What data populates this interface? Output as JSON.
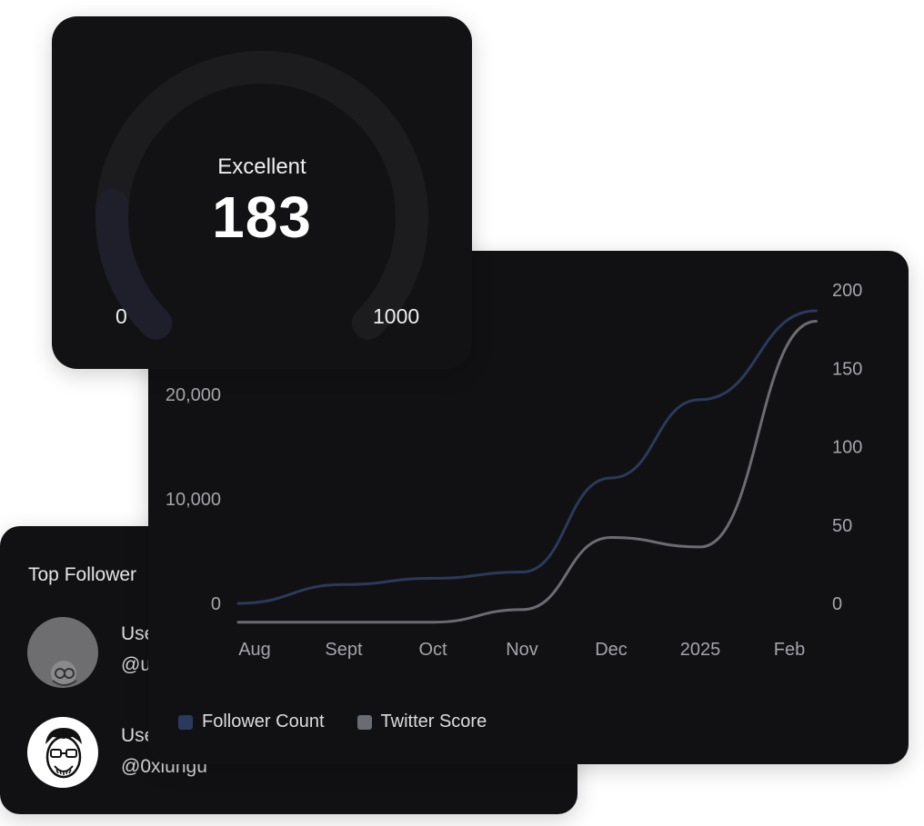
{
  "gauge": {
    "rating": "Excellent",
    "score": "183",
    "min_label": "0",
    "max_label": "1000",
    "fill_fraction": 0.183,
    "track_color": "#1c1c1f",
    "fill_color": "#1f1f2b"
  },
  "followers": {
    "title": "Top Follower",
    "items": [
      {
        "name": "Use",
        "handle": "@u",
        "avatar_icon": "grey-avatar-icon"
      },
      {
        "name": "Use",
        "handle": "@0xiungu",
        "avatar_icon": "cartoon-face-avatar-icon"
      }
    ]
  },
  "legend": {
    "items": [
      {
        "label": "Follower Count",
        "color": "#2a3a5c"
      },
      {
        "label": "Twitter Score",
        "color": "#6b6b72"
      }
    ]
  },
  "chart_data": {
    "type": "line",
    "categories": [
      "Aug",
      "Sept",
      "Oct",
      "Nov",
      "Dec",
      "2025",
      "Feb"
    ],
    "left_axis": {
      "ticks": [
        "0",
        "10,000",
        "20,000"
      ],
      "range": [
        0,
        30000
      ]
    },
    "right_axis": {
      "ticks": [
        "0",
        "50",
        "100",
        "150",
        "200"
      ],
      "range": [
        0,
        200
      ]
    },
    "series": [
      {
        "name": "Follower Count",
        "axis": "left",
        "color": "#2a3a5c",
        "values": [
          0,
          1800,
          2400,
          3000,
          12000,
          19500,
          28000
        ],
        "x": [
          0,
          1,
          2,
          3,
          4,
          5,
          6.3
        ]
      },
      {
        "name": "Twitter Score",
        "axis": "right",
        "color": "#6b6b72",
        "values": [
          -12,
          -12,
          -12,
          -4,
          42,
          36,
          180
        ],
        "x": [
          0,
          1,
          2,
          3,
          4,
          5,
          6.3
        ]
      }
    ]
  }
}
